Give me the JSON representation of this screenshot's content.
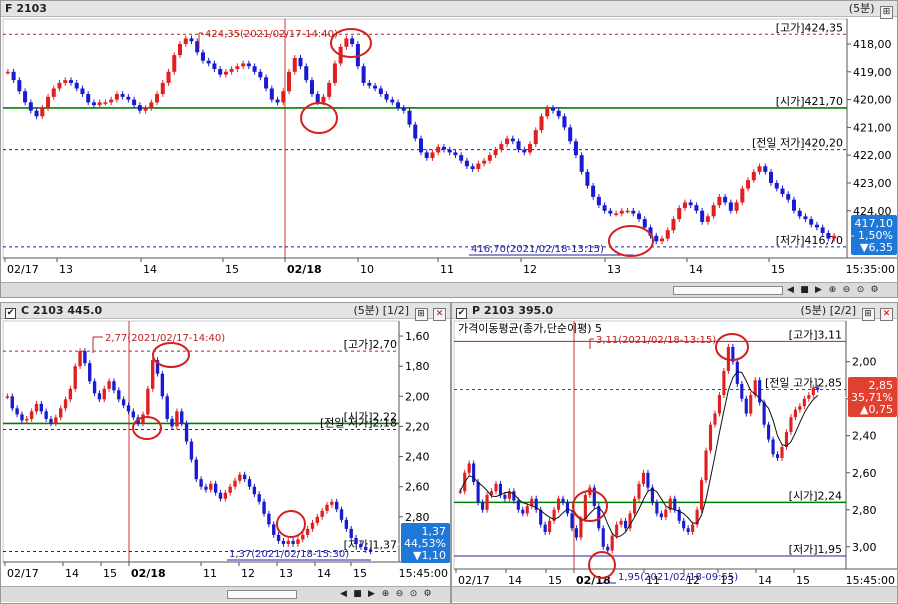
{
  "panels": {
    "top": {
      "title": "F 2103",
      "period": "(5분)",
      "price_axis": [
        "424,00",
        "423,00",
        "422,00",
        "421,00",
        "420,00",
        "419,00",
        "418,00"
      ],
      "time_axis": [
        "02/17",
        "13",
        "14",
        "15",
        "02/18",
        "10",
        "11",
        "12",
        "13",
        "14",
        "15",
        "15:35:00"
      ],
      "ref_labels": [
        {
          "text": "[고가]424,35",
          "value": 424.35,
          "color": "#b22222",
          "style": "dash"
        },
        {
          "text": "[시가]421,70",
          "value": 421.7,
          "color": "#008000",
          "style": "solid"
        },
        {
          "text": "[전일 저가]420,20",
          "value": 420.2,
          "color": "#2020a0",
          "style": "dash"
        },
        {
          "text": "[저가]416,70",
          "value": 416.7,
          "color": "#2020a0",
          "style": "dash"
        }
      ],
      "annot_high": "424,35(2021/02/17-14:40)",
      "annot_low": "416,70(2021/02/18-13:15)",
      "badge": {
        "line1": "417,10",
        "line2": "- 1,50%",
        "line3": "▼6,35"
      }
    },
    "bottom_left": {
      "title": "C 2103 445.0",
      "period": "(5분)",
      "pager": "[1/2]",
      "price_axis": [
        "2,80",
        "2,60",
        "2,40",
        "2,20",
        "2,00",
        "1,80",
        "1,60"
      ],
      "time_axis": [
        "02/17",
        "14",
        "15",
        "02/18",
        "11",
        "12",
        "13",
        "14",
        "15",
        "15:45:00"
      ],
      "ref_labels": [
        {
          "text": "[고가]2,70",
          "value": 2.7,
          "color": "#b22222",
          "style": "dash"
        },
        {
          "text": "[시가]2,22",
          "value": 2.22,
          "color": "#008000",
          "style": "solid"
        },
        {
          "text": "[전일 저가]2,18",
          "value": 2.18,
          "color": "#2020a0",
          "style": "dash"
        },
        {
          "text": "[저가]1,37",
          "value": 1.37,
          "color": "#2020a0",
          "style": "dash"
        }
      ],
      "annot_high": "2,77(2021/02/17-14:40)",
      "annot_low": "1,37(2021/02/18-15:30)",
      "badge": {
        "line1": "1,37",
        "line2": "- 44,53%",
        "line3": "▼1,10"
      }
    },
    "bottom_right": {
      "title": "P 2103 395.0",
      "period": "(5분)",
      "pager": "[2/2]",
      "ma_legend": "가격이동평균(종가,단순이평) 5",
      "price_axis": [
        "3,00",
        "2,80",
        "2,60",
        "2,40",
        "2,20",
        "2,00"
      ],
      "time_axis": [
        "02/17",
        "14",
        "15",
        "02/18",
        "11",
        "12",
        "13",
        "14",
        "15",
        "15:45:00"
      ],
      "ref_labels": [
        {
          "text": "[고가]3,11",
          "value": 3.11,
          "color": "#b22222",
          "style": "solid"
        },
        {
          "text": "[전일 고가]2,85",
          "value": 2.85,
          "color": "#b22222",
          "style": "dash"
        },
        {
          "text": "[시가]2,24",
          "value": 2.24,
          "color": "#008000",
          "style": "solid"
        },
        {
          "text": "[저가]1,95",
          "value": 1.95,
          "color": "#2020a0",
          "style": "solid"
        }
      ],
      "annot_high": "3,11(2021/02/18-13:15)",
      "annot_low": "1,95(2021/02/18-09:55)",
      "badge": {
        "line1": "2,85",
        "line2": "+ 35,71%",
        "line3": "▲0,75"
      }
    }
  },
  "chart_data": [
    {
      "type": "candlestick",
      "title": "F 2103",
      "ylim": [
        416.3,
        424.9
      ],
      "yticks": [
        418,
        419,
        420,
        421,
        422,
        423,
        424
      ],
      "session_marks": [
        "02/17",
        "13",
        "14",
        "15",
        "02/18",
        "10",
        "11",
        "12",
        "13",
        "14",
        "15"
      ],
      "close": [
        423.0,
        422.7,
        422.3,
        421.9,
        421.6,
        421.4,
        421.7,
        422.1,
        422.4,
        422.6,
        422.7,
        422.6,
        422.4,
        422.2,
        421.9,
        421.8,
        421.9,
        421.9,
        422.0,
        422.2,
        422.1,
        422.0,
        421.8,
        421.6,
        421.7,
        421.9,
        422.2,
        422.6,
        423.0,
        423.6,
        424.0,
        424.2,
        424.1,
        423.7,
        423.4,
        423.3,
        423.1,
        422.9,
        423.0,
        423.1,
        423.2,
        423.3,
        423.2,
        423.0,
        422.8,
        422.4,
        422.0,
        421.9,
        422.3,
        423.0,
        423.5,
        423.2,
        422.7,
        422.2,
        421.9,
        422.1,
        422.6,
        423.3,
        423.9,
        424.2,
        424.0,
        423.2,
        422.6,
        422.5,
        422.4,
        422.2,
        422.0,
        421.9,
        421.7,
        421.6,
        421.1,
        420.6,
        420.1,
        419.9,
        420.1,
        420.3,
        420.2,
        420.1,
        420.0,
        419.8,
        419.6,
        419.5,
        419.7,
        419.8,
        420.0,
        420.2,
        420.4,
        420.6,
        420.5,
        420.2,
        420.1,
        420.4,
        420.9,
        421.4,
        421.7,
        421.6,
        421.4,
        421.0,
        420.5,
        420.0,
        419.4,
        418.9,
        418.5,
        418.2,
        418.0,
        417.9,
        417.9,
        418.0,
        418.0,
        417.9,
        417.7,
        417.4,
        417.1,
        416.9,
        417.0,
        417.3,
        417.7,
        418.1,
        418.3,
        418.2,
        418.0,
        417.6,
        417.8,
        418.2,
        418.5,
        418.3,
        418.0,
        418.3,
        418.8,
        419.1,
        419.4,
        419.6,
        419.4,
        419.0,
        418.8,
        418.6,
        418.4,
        418.0,
        417.8,
        417.7,
        417.5,
        417.4,
        417.2,
        417.0,
        417.1
      ]
    },
    {
      "type": "candlestick",
      "title": "C 2103 445.0",
      "ylim": [
        1.3,
        2.9
      ],
      "yticks": [
        1.6,
        1.8,
        2.0,
        2.2,
        2.4,
        2.6,
        2.8
      ],
      "session_marks": [
        "02/17",
        "14",
        "15",
        "02/18",
        "11",
        "12",
        "13",
        "14",
        "15"
      ],
      "close": [
        2.4,
        2.32,
        2.28,
        2.24,
        2.25,
        2.3,
        2.35,
        2.3,
        2.25,
        2.22,
        2.26,
        2.32,
        2.38,
        2.45,
        2.6,
        2.7,
        2.62,
        2.5,
        2.42,
        2.38,
        2.45,
        2.5,
        2.44,
        2.38,
        2.34,
        2.3,
        2.26,
        2.22,
        2.28,
        2.45,
        2.64,
        2.55,
        2.4,
        2.25,
        2.2,
        2.3,
        2.22,
        2.1,
        1.98,
        1.85,
        1.8,
        1.78,
        1.82,
        1.76,
        1.72,
        1.76,
        1.8,
        1.84,
        1.88,
        1.85,
        1.8,
        1.75,
        1.7,
        1.62,
        1.55,
        1.48,
        1.44,
        1.42,
        1.44,
        1.42,
        1.45,
        1.48,
        1.52,
        1.56,
        1.6,
        1.64,
        1.68,
        1.7,
        1.65,
        1.58,
        1.52,
        1.46,
        1.42,
        1.4,
        1.38,
        1.37
      ]
    },
    {
      "type": "candlestick",
      "title": "P 2103 395.0",
      "ylim": [
        1.88,
        3.22
      ],
      "yticks": [
        2.0,
        2.2,
        2.4,
        2.6,
        2.8,
        3.0
      ],
      "session_marks": [
        "02/17",
        "14",
        "15",
        "02/18",
        "11",
        "12",
        "13",
        "14",
        "15"
      ],
      "close": [
        2.3,
        2.4,
        2.45,
        2.35,
        2.24,
        2.2,
        2.28,
        2.3,
        2.34,
        2.28,
        2.26,
        2.3,
        2.25,
        2.2,
        2.18,
        2.22,
        2.26,
        2.2,
        2.12,
        2.08,
        2.14,
        2.2,
        2.26,
        2.24,
        2.18,
        2.1,
        2.05,
        2.15,
        2.28,
        2.32,
        2.22,
        2.1,
        2.0,
        1.98,
        2.06,
        2.12,
        2.14,
        2.1,
        2.18,
        2.26,
        2.34,
        2.4,
        2.32,
        2.24,
        2.18,
        2.16,
        2.2,
        2.26,
        2.2,
        2.14,
        2.1,
        2.08,
        2.12,
        2.2,
        2.36,
        2.52,
        2.66,
        2.72,
        2.82,
        2.95,
        3.08,
        3.0,
        2.88,
        2.8,
        2.72,
        2.82,
        2.9,
        2.78,
        2.66,
        2.58,
        2.5,
        2.48,
        2.54,
        2.62,
        2.7,
        2.74,
        2.76,
        2.8,
        2.82,
        2.86,
        2.85
      ]
    }
  ]
}
